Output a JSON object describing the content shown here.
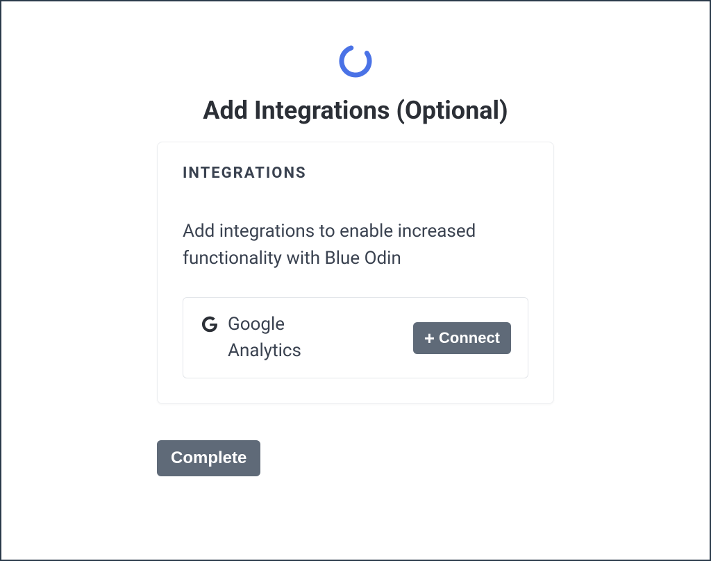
{
  "page": {
    "title": "Add Integrations (Optional)"
  },
  "card": {
    "header": "INTEGRATIONS",
    "description": "Add integrations to enable increased functionality with Blue Odin"
  },
  "integrations": [
    {
      "name": "Google Analytics",
      "icon": "google-icon",
      "connect_label": "Connect"
    }
  ],
  "actions": {
    "complete_label": "Complete"
  }
}
